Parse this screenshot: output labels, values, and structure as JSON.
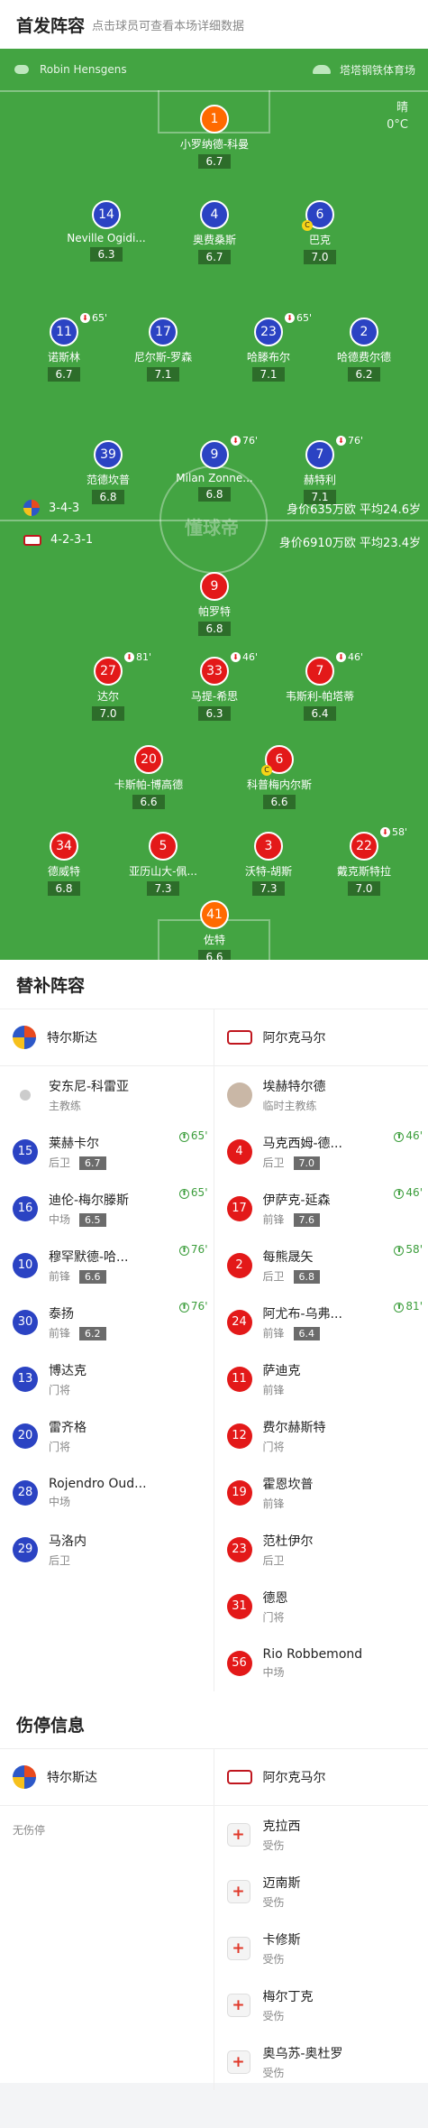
{
  "header": {
    "title": "首发阵容",
    "subtitle": "点击球员可查看本场详细数据"
  },
  "pitch": {
    "referee": "Robin Hensgens",
    "stadium": "塔塔钢铁体育场",
    "weather": "晴",
    "temperature": "0°C",
    "watermark": "懂球帝",
    "home_formation": "3-4-3",
    "home_value": "身价635万欧  平均24.6岁",
    "away_formation": "4-2-3-1",
    "away_value": "身价6910万欧  平均23.4岁",
    "home_players": [
      {
        "num": "1",
        "name": "小罗纳德-科曼",
        "rating": "6.7",
        "color": "orange"
      },
      {
        "num": "14",
        "name": "Neville Ogidi...",
        "rating": "6.3",
        "color": "blue"
      },
      {
        "num": "4",
        "name": "奥费桑斯",
        "rating": "6.7",
        "color": "blue"
      },
      {
        "num": "6",
        "name": "巴克",
        "rating": "7.0",
        "color": "blue",
        "captain": "C"
      },
      {
        "num": "11",
        "name": "诺斯林",
        "rating": "6.7",
        "color": "blue",
        "event": "65'"
      },
      {
        "num": "17",
        "name": "尼尔斯-罗森",
        "rating": "7.1",
        "color": "blue"
      },
      {
        "num": "23",
        "name": "哈滕布尔",
        "rating": "7.1",
        "color": "blue",
        "event": "65'"
      },
      {
        "num": "2",
        "name": "哈德费尔德",
        "rating": "6.2",
        "color": "blue"
      },
      {
        "num": "39",
        "name": "范德坎普",
        "rating": "6.8",
        "color": "blue"
      },
      {
        "num": "9",
        "name": "Milan Zonne...",
        "rating": "6.8",
        "color": "blue",
        "event": "76'"
      },
      {
        "num": "7",
        "name": "赫特利",
        "rating": "7.1",
        "color": "blue",
        "event": "76'"
      }
    ],
    "away_players": [
      {
        "num": "9",
        "name": "帕罗特",
        "rating": "6.8",
        "color": "red"
      },
      {
        "num": "27",
        "name": "达尔",
        "rating": "7.0",
        "color": "red",
        "event": "81'"
      },
      {
        "num": "33",
        "name": "马提-希思",
        "rating": "6.3",
        "color": "red",
        "event": "46'"
      },
      {
        "num": "7",
        "name": "韦斯利-帕塔蒂",
        "rating": "6.4",
        "color": "red",
        "event": "46'"
      },
      {
        "num": "20",
        "name": "卡斯帕-博高德",
        "rating": "6.6",
        "color": "red"
      },
      {
        "num": "6",
        "name": "科普梅内尔斯",
        "rating": "6.6",
        "color": "red",
        "captain": "C"
      },
      {
        "num": "34",
        "name": "德威特",
        "rating": "6.8",
        "color": "red"
      },
      {
        "num": "5",
        "name": "亚历山大-佩...",
        "rating": "7.3",
        "color": "red"
      },
      {
        "num": "3",
        "name": "沃特-胡斯",
        "rating": "7.3",
        "color": "red"
      },
      {
        "num": "22",
        "name": "戴克斯特拉",
        "rating": "7.0",
        "color": "red",
        "event": "58'"
      },
      {
        "num": "41",
        "name": "佐特",
        "rating": "6.6",
        "color": "orange"
      }
    ]
  },
  "subs": {
    "title": "替补阵容",
    "home_team": "特尔斯达",
    "away_team": "阿尔克马尔",
    "home_coach": {
      "name": "安东尼-科雷亚",
      "role": "主教练"
    },
    "away_coach": {
      "name": "埃赫特尔德",
      "role": "临时主教练"
    },
    "home": [
      {
        "num": "15",
        "name": "莱赫卡尔",
        "pos": "后卫",
        "rating": "6.7",
        "event": "65'"
      },
      {
        "num": "16",
        "name": "迪伦-梅尔滕斯",
        "pos": "中场",
        "rating": "6.5",
        "event": "65'"
      },
      {
        "num": "10",
        "name": "穆罕默德-哈...",
        "pos": "前锋",
        "rating": "6.6",
        "event": "76'"
      },
      {
        "num": "30",
        "name": "泰扬",
        "pos": "前锋",
        "rating": "6.2",
        "event": "76'"
      },
      {
        "num": "13",
        "name": "博达克",
        "pos": "门将"
      },
      {
        "num": "20",
        "name": "雷齐格",
        "pos": "门将"
      },
      {
        "num": "28",
        "name": "Rojendro Oud...",
        "pos": "中场"
      },
      {
        "num": "29",
        "name": "马洛内",
        "pos": "后卫"
      }
    ],
    "away": [
      {
        "num": "4",
        "name": "马克西姆-德...",
        "pos": "后卫",
        "rating": "7.0",
        "event": "46'"
      },
      {
        "num": "17",
        "name": "伊萨克-延森",
        "pos": "前锋",
        "rating": "7.6",
        "event": "46'"
      },
      {
        "num": "2",
        "name": "每熊晟矢",
        "pos": "后卫",
        "rating": "6.8",
        "event": "58'"
      },
      {
        "num": "24",
        "name": "阿尤布-乌弗...",
        "pos": "前锋",
        "rating": "6.4",
        "event": "81'"
      },
      {
        "num": "11",
        "name": "萨迪克",
        "pos": "前锋"
      },
      {
        "num": "12",
        "name": "费尔赫斯特",
        "pos": "门将"
      },
      {
        "num": "19",
        "name": "霍恩坎普",
        "pos": "前锋"
      },
      {
        "num": "23",
        "name": "范杜伊尔",
        "pos": "后卫"
      },
      {
        "num": "31",
        "name": "德恩",
        "pos": "门将"
      },
      {
        "num": "56",
        "name": "Rio Robbemond",
        "pos": "中场"
      }
    ]
  },
  "injuries": {
    "title": "伤停信息",
    "home_team": "特尔斯达",
    "away_team": "阿尔克马尔",
    "home_none": "无伤停",
    "away": [
      {
        "name": "克拉西",
        "status": "受伤"
      },
      {
        "name": "迈南斯",
        "status": "受伤"
      },
      {
        "name": "卡修斯",
        "status": "受伤"
      },
      {
        "name": "梅尔丁克",
        "status": "受伤"
      },
      {
        "name": "奥乌苏-奥杜罗",
        "status": "受伤"
      }
    ]
  }
}
